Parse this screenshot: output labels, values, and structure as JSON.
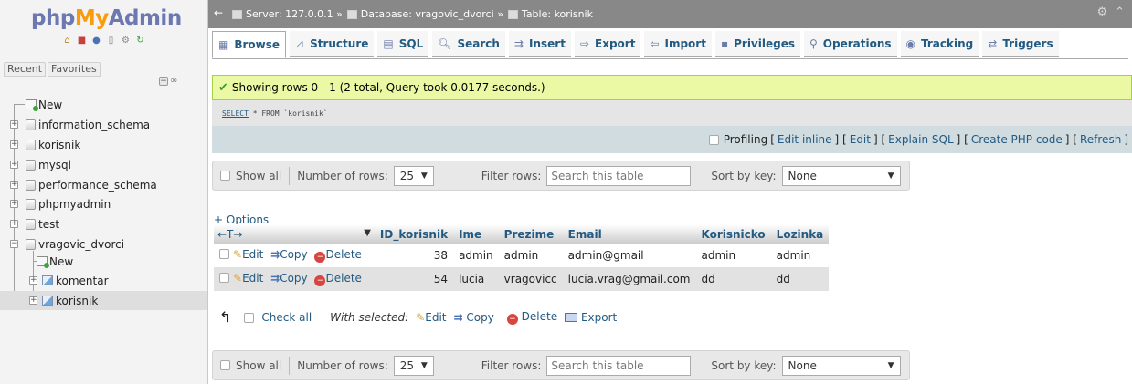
{
  "nav": {
    "logo": {
      "php": "php",
      "my": "My",
      "admin": "Admin"
    },
    "icons": [
      "home-icon",
      "exit-icon",
      "database-icon",
      "docs-icon",
      "settings-icon",
      "reload-icon"
    ],
    "tabs": [
      "Recent",
      "Favorites"
    ],
    "tree": [
      {
        "label": "New",
        "kind": "new"
      },
      {
        "label": "information_schema",
        "kind": "db"
      },
      {
        "label": "korisnik",
        "kind": "db"
      },
      {
        "label": "mysql",
        "kind": "db"
      },
      {
        "label": "performance_schema",
        "kind": "db"
      },
      {
        "label": "phpmyadmin",
        "kind": "db"
      },
      {
        "label": "test",
        "kind": "db"
      },
      {
        "label": "vragovic_dvorci",
        "kind": "db-open"
      },
      {
        "label": "New",
        "kind": "new-child"
      },
      {
        "label": "komentar",
        "kind": "table"
      },
      {
        "label": "korisnik",
        "kind": "table-selected"
      }
    ]
  },
  "topbar": {
    "server_label": "Server: 127.0.0.1 »",
    "database_label": "Database: vragovic_dvorci »",
    "table_label": "Table: korisnik"
  },
  "tabs": [
    {
      "label": "Browse",
      "icon": "▦"
    },
    {
      "label": "Structure",
      "icon": "⊿"
    },
    {
      "label": "SQL",
      "icon": "▤"
    },
    {
      "label": "Search",
      "icon": "🔍︎"
    },
    {
      "label": "Insert",
      "icon": "⇉"
    },
    {
      "label": "Export",
      "icon": "⇨"
    },
    {
      "label": "Import",
      "icon": "⇦"
    },
    {
      "label": "Privileges",
      "icon": "▪"
    },
    {
      "label": "Operations",
      "icon": "⚲"
    },
    {
      "label": "Tracking",
      "icon": "◉"
    },
    {
      "label": "Triggers",
      "icon": "⇄"
    }
  ],
  "success_message": "Showing rows 0 - 1 (2 total, Query took 0.0177 seconds.)",
  "sql": {
    "select": "SELECT",
    "rest": " * FROM ",
    "table": "`korisnik`"
  },
  "profiling": {
    "label": "Profiling",
    "links": [
      "Edit inline",
      "Edit",
      "Explain SQL",
      "Create PHP code",
      "Refresh"
    ]
  },
  "table_nav": {
    "show_all": "Show all",
    "number_of_rows_label": "Number of rows:",
    "rows_value": "25",
    "filter_label": "Filter rows:",
    "filter_placeholder": "Search this table",
    "sort_label": "Sort by key:",
    "sort_value": "None"
  },
  "options_label": "+ Options",
  "results": {
    "lead_header": "←T→",
    "columns": [
      "ID_korisnik",
      "Ime",
      "Prezime",
      "Email",
      "Korisnicko",
      "Lozinka"
    ],
    "actions": {
      "edit": "Edit",
      "copy": "Copy",
      "delete": "Delete"
    },
    "rows": [
      [
        "38",
        "admin",
        "admin",
        "admin@gmail",
        "admin",
        "admin"
      ],
      [
        "54",
        "lucia",
        "vragovicc",
        "lucia.vrag@gmail.com",
        "dd",
        "dd"
      ]
    ]
  },
  "bulk": {
    "check_all": "Check all",
    "with_selected": "With selected:",
    "edit": "Edit",
    "copy": "Copy",
    "delete": "Delete",
    "export": "Export"
  }
}
